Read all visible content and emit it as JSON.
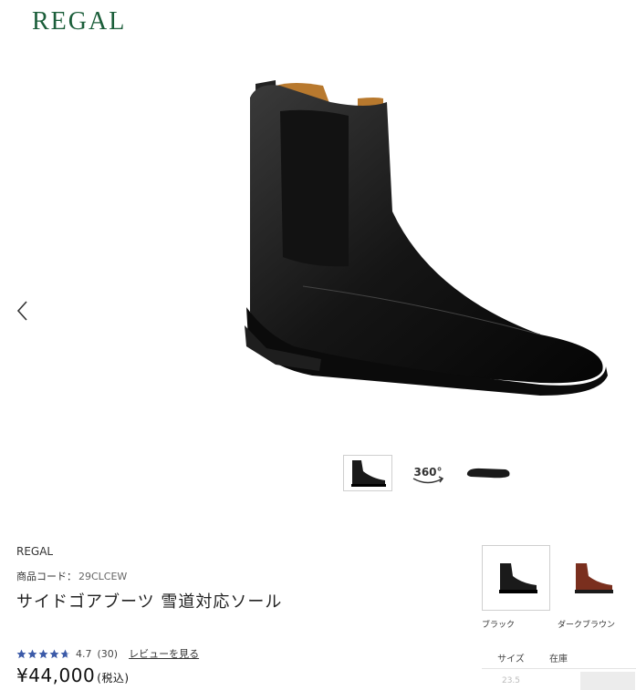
{
  "header": {
    "logo": "REGAL"
  },
  "gallery": {
    "prev_icon": "chevron-left-icon",
    "thumbnails": [
      {
        "name": "thumb-side-view",
        "active": true
      },
      {
        "name": "thumb-360-view",
        "label": "360°"
      },
      {
        "name": "thumb-sole-view"
      }
    ]
  },
  "product": {
    "brand": "REGAL",
    "code_label": "商品コード：",
    "code_value": "29CLCEW",
    "title": "サイドゴアブーツ 雪道対応ソール",
    "rating": {
      "stars": 4.7,
      "value": "4.7",
      "count": "(30)",
      "review_link": "レビューを見る"
    },
    "price": "¥44,000",
    "price_tax": "(税込)"
  },
  "colors": [
    {
      "label": "ブラック",
      "hex": "#1a1a1a",
      "active": true
    },
    {
      "label": "ダークブラウン",
      "hex": "#7a2f1e",
      "active": false
    }
  ],
  "size_table": {
    "col_size": "サイズ",
    "col_stock": "在庫",
    "rows": [
      {
        "size": "23.5"
      }
    ]
  },
  "colors_theme": {
    "brand_green": "#1b5e3a",
    "star_blue": "#3b5aa8"
  }
}
